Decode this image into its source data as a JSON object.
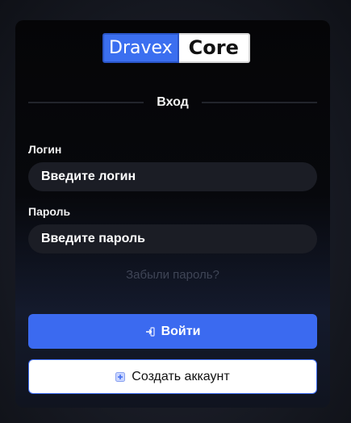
{
  "logo": {
    "part1": "Dravex",
    "part2": "Core"
  },
  "form": {
    "title": "Вход",
    "login_label": "Логин",
    "login_placeholder": "Введите логин",
    "password_label": "Пароль",
    "password_placeholder": "Введите пароль",
    "forgot_link": "Забыли пароль?",
    "submit_label": "Войти",
    "create_label": "Создать аккаунт",
    "submit_icon": "login-icon",
    "create_icon": "plus-square-icon"
  },
  "colors": {
    "accent": "#3b6af0",
    "card_bg": "#050507",
    "input_bg": "#1b1d25",
    "muted_link": "#3f4556"
  }
}
